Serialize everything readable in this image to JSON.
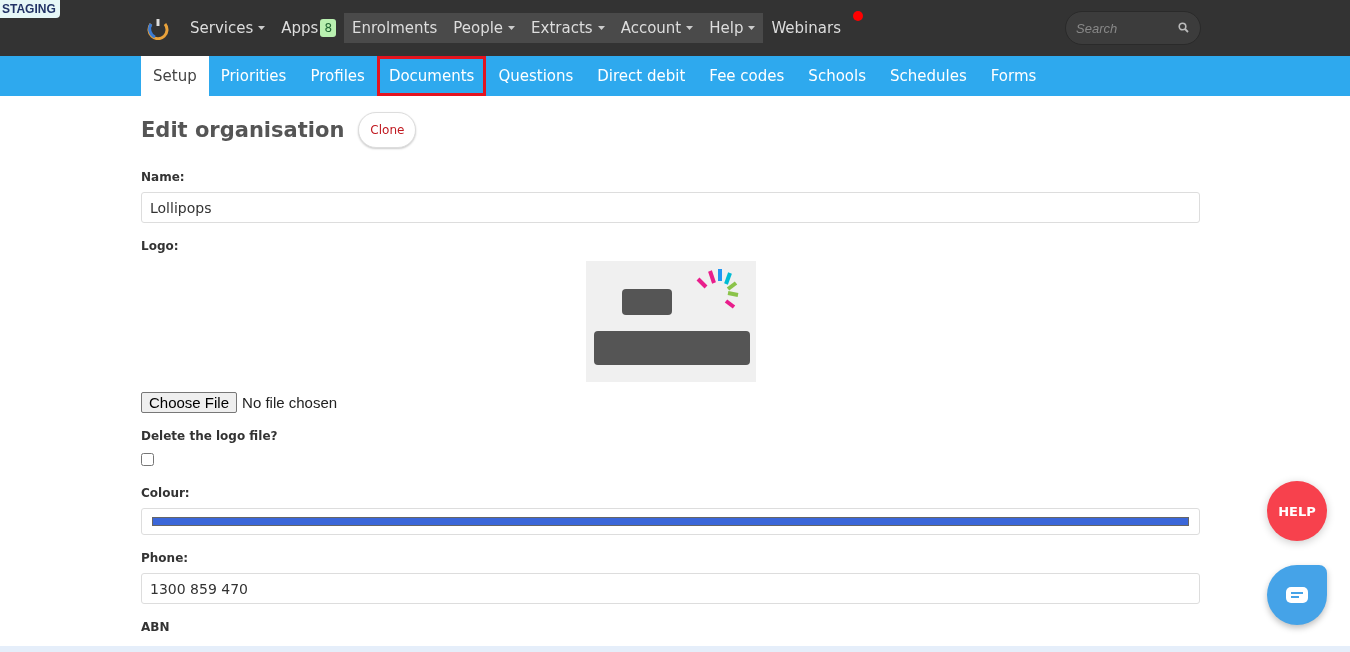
{
  "environment_badge": "STAGING",
  "nav": {
    "items": [
      {
        "label": "Services",
        "dropdown": true,
        "grouped": false
      },
      {
        "label": "Apps",
        "badge": "8",
        "dropdown": false,
        "grouped": false
      },
      {
        "label": "Enrolments",
        "dropdown": false,
        "grouped": true
      },
      {
        "label": "People",
        "dropdown": true,
        "grouped": true
      },
      {
        "label": "Extracts",
        "dropdown": true,
        "grouped": true
      },
      {
        "label": "Account",
        "dropdown": true,
        "grouped": true
      },
      {
        "label": "Help",
        "dropdown": true,
        "grouped": true
      },
      {
        "label": "Webinars",
        "dropdown": false,
        "grouped": false,
        "notification": true
      }
    ],
    "search": {
      "placeholder": "Search"
    }
  },
  "tabs": [
    {
      "label": "Setup",
      "selected": true,
      "highlighted": false
    },
    {
      "label": "Priorities",
      "selected": false,
      "highlighted": false
    },
    {
      "label": "Profiles",
      "selected": false,
      "highlighted": false
    },
    {
      "label": "Documents",
      "selected": false,
      "highlighted": true
    },
    {
      "label": "Questions",
      "selected": false,
      "highlighted": false
    },
    {
      "label": "Direct debit",
      "selected": false,
      "highlighted": false
    },
    {
      "label": "Fee codes",
      "selected": false,
      "highlighted": false
    },
    {
      "label": "Schools",
      "selected": false,
      "highlighted": false
    },
    {
      "label": "Schedules",
      "selected": false,
      "highlighted": false
    },
    {
      "label": "Forms",
      "selected": false,
      "highlighted": false
    }
  ],
  "page": {
    "title": "Edit organisation",
    "clone_button": "Clone"
  },
  "form": [
    {
      "kind": "text",
      "label": "Name:",
      "value": "Lollipops"
    },
    {
      "kind": "logo",
      "label": "Logo:",
      "file_button": "Choose File",
      "file_status": "No file chosen"
    },
    {
      "kind": "checkbox",
      "label": "Delete the logo file?",
      "checked": false
    },
    {
      "kind": "color",
      "label": "Colour:",
      "color": "#3b67d9"
    },
    {
      "kind": "text",
      "label": "Phone:",
      "value": "1300 859 470"
    },
    {
      "kind": "label",
      "label": "ABN"
    }
  ],
  "help_button": "HELP"
}
